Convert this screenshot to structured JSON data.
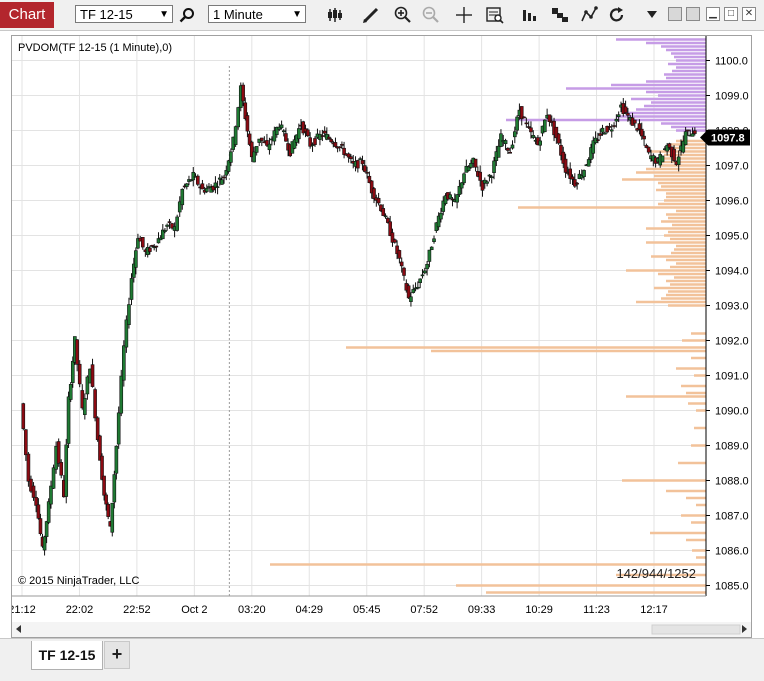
{
  "window": {
    "tab_label": "Chart",
    "instrument": "TF 12-15",
    "interval": "1 Minute"
  },
  "toolbar": {
    "icons": [
      "search-icon",
      "bar-type-icon",
      "draw-pencil-icon",
      "zoom-in-icon",
      "zoom-out-icon",
      "crosshair-icon",
      "data-box-icon",
      "indicators-icon",
      "strategies-icon",
      "drawing-tools-icon",
      "reload-icon",
      "dropdown-icon"
    ]
  },
  "chart": {
    "indicator_label": "PVDOM(TF 12-15 (1 Minute),0)",
    "copyright": "© 2015 NinjaTrader, LLC",
    "dom_totals": "142/944/1252",
    "last_price": "1097.8",
    "colors": {
      "up_candle": "#1f7a33",
      "down_candle": "#8b0a12",
      "ask_volume": "#c69ce6",
      "bid_volume": "#f2c29a",
      "grid": "#e3e3e3",
      "price_marker": "#000000"
    }
  },
  "chart_data": {
    "type": "candlestick",
    "ylim": [
      1084.7,
      1100.7
    ],
    "y_ticks": [
      "1085.0",
      "1086.0",
      "1087.0",
      "1088.0",
      "1089.0",
      "1090.0",
      "1091.0",
      "1092.0",
      "1093.0",
      "1094.0",
      "1095.0",
      "1096.0",
      "1097.0",
      "1098.0",
      "1099.0",
      "1100.0"
    ],
    "x_ticks": [
      "21:12",
      "22:02",
      "22:52",
      "Oct 2",
      "03:20",
      "04:29",
      "05:45",
      "07:52",
      "09:33",
      "10:29",
      "11:23",
      "12:17"
    ],
    "session_break": "Oct 2",
    "price_path": [
      [
        0,
        1090.2
      ],
      [
        5,
        1088.0
      ],
      [
        10,
        1087.4
      ],
      [
        14,
        1086.0
      ],
      [
        18,
        1087.3
      ],
      [
        23,
        1089.0
      ],
      [
        28,
        1087.6
      ],
      [
        31,
        1090.3
      ],
      [
        35,
        1092.0
      ],
      [
        40,
        1090.0
      ],
      [
        45,
        1091.3
      ],
      [
        50,
        1089.2
      ],
      [
        54,
        1087.6
      ],
      [
        58,
        1086.6
      ],
      [
        62,
        1089.0
      ],
      [
        67,
        1091.8
      ],
      [
        72,
        1093.8
      ],
      [
        76,
        1095.0
      ],
      [
        81,
        1094.5
      ],
      [
        88,
        1094.8
      ],
      [
        95,
        1095.3
      ],
      [
        100,
        1095.2
      ],
      [
        105,
        1096.3
      ],
      [
        112,
        1096.7
      ],
      [
        118,
        1096.3
      ],
      [
        125,
        1096.4
      ],
      [
        132,
        1096.7
      ],
      [
        138,
        1097.7
      ],
      [
        143,
        1099.2
      ],
      [
        150,
        1097.2
      ],
      [
        155,
        1097.8
      ],
      [
        160,
        1097.5
      ],
      [
        168,
        1098.2
      ],
      [
        175,
        1097.4
      ],
      [
        182,
        1098.2
      ],
      [
        188,
        1097.6
      ],
      [
        196,
        1097.9
      ],
      [
        203,
        1097.7
      ],
      [
        210,
        1097.4
      ],
      [
        216,
        1097.0
      ],
      [
        222,
        1097.1
      ],
      [
        228,
        1096.3
      ],
      [
        234,
        1095.8
      ],
      [
        240,
        1095.1
      ],
      [
        246,
        1094.3
      ],
      [
        252,
        1093.2
      ],
      [
        258,
        1093.6
      ],
      [
        264,
        1094.2
      ],
      [
        270,
        1095.3
      ],
      [
        276,
        1096.2
      ],
      [
        282,
        1095.9
      ],
      [
        288,
        1096.8
      ],
      [
        294,
        1097.1
      ],
      [
        300,
        1096.4
      ],
      [
        306,
        1096.8
      ],
      [
        312,
        1097.8
      ],
      [
        318,
        1097.4
      ],
      [
        324,
        1098.6
      ],
      [
        330,
        1098.0
      ],
      [
        336,
        1097.6
      ],
      [
        342,
        1098.5
      ],
      [
        348,
        1097.8
      ],
      [
        354,
        1096.9
      ],
      [
        360,
        1096.5
      ],
      [
        366,
        1096.9
      ],
      [
        372,
        1097.6
      ],
      [
        378,
        1098.0
      ],
      [
        384,
        1098.1
      ],
      [
        390,
        1098.7
      ],
      [
        396,
        1098.3
      ],
      [
        402,
        1098.0
      ],
      [
        408,
        1097.3
      ],
      [
        414,
        1097.1
      ],
      [
        420,
        1097.6
      ],
      [
        426,
        1097.1
      ],
      [
        432,
        1097.9
      ],
      [
        438,
        1098.0
      ]
    ],
    "candles_per_step": 1,
    "volume_profile": {
      "tick": 0.1,
      "ask": [
        {
          "price": 1100.6,
          "volume": 90
        },
        {
          "price": 1100.5,
          "volume": 60
        },
        {
          "price": 1100.4,
          "volume": 45
        },
        {
          "price": 1100.3,
          "volume": 40
        },
        {
          "price": 1100.2,
          "volume": 35
        },
        {
          "price": 1100.1,
          "volume": 32
        },
        {
          "price": 1100.0,
          "volume": 30
        },
        {
          "price": 1099.9,
          "volume": 38
        },
        {
          "price": 1099.8,
          "volume": 30
        },
        {
          "price": 1099.7,
          "volume": 34
        },
        {
          "price": 1099.6,
          "volume": 42
        },
        {
          "price": 1099.5,
          "volume": 40
        },
        {
          "price": 1099.4,
          "volume": 60
        },
        {
          "price": 1099.3,
          "volume": 95
        },
        {
          "price": 1099.2,
          "volume": 140
        },
        {
          "price": 1099.1,
          "volume": 60
        },
        {
          "price": 1099.0,
          "volume": 48
        },
        {
          "price": 1098.9,
          "volume": 75
        },
        {
          "price": 1098.8,
          "volume": 55
        },
        {
          "price": 1098.7,
          "volume": 62
        },
        {
          "price": 1098.6,
          "volume": 70
        },
        {
          "price": 1098.5,
          "volume": 80
        },
        {
          "price": 1098.4,
          "volume": 90
        },
        {
          "price": 1098.3,
          "volume": 200
        },
        {
          "price": 1098.2,
          "volume": 45
        },
        {
          "price": 1098.1,
          "volume": 35
        },
        {
          "price": 1098.0,
          "volume": 30
        }
      ],
      "bid": [
        {
          "price": 1097.7,
          "volume": 30
        },
        {
          "price": 1097.6,
          "volume": 35
        },
        {
          "price": 1097.5,
          "volume": 40
        },
        {
          "price": 1097.4,
          "volume": 55
        },
        {
          "price": 1097.3,
          "volume": 42
        },
        {
          "price": 1097.2,
          "volume": 48
        },
        {
          "price": 1097.1,
          "volume": 50
        },
        {
          "price": 1097.0,
          "volume": 45
        },
        {
          "price": 1096.9,
          "volume": 60
        },
        {
          "price": 1096.8,
          "volume": 70
        },
        {
          "price": 1096.7,
          "volume": 52
        },
        {
          "price": 1096.6,
          "volume": 84
        },
        {
          "price": 1096.5,
          "volume": 48
        },
        {
          "price": 1096.4,
          "volume": 45
        },
        {
          "price": 1096.3,
          "volume": 50
        },
        {
          "price": 1096.2,
          "volume": 40
        },
        {
          "price": 1096.1,
          "volume": 40
        },
        {
          "price": 1096.0,
          "volume": 42
        },
        {
          "price": 1095.9,
          "volume": 48
        },
        {
          "price": 1095.8,
          "volume": 188
        },
        {
          "price": 1095.7,
          "volume": 30
        },
        {
          "price": 1095.6,
          "volume": 40
        },
        {
          "price": 1095.5,
          "volume": 38
        },
        {
          "price": 1095.4,
          "volume": 45
        },
        {
          "price": 1095.3,
          "volume": 34
        },
        {
          "price": 1095.2,
          "volume": 60
        },
        {
          "price": 1095.1,
          "volume": 38
        },
        {
          "price": 1095.0,
          "volume": 42
        },
        {
          "price": 1094.9,
          "volume": 36
        },
        {
          "price": 1094.8,
          "volume": 60
        },
        {
          "price": 1094.7,
          "volume": 30
        },
        {
          "price": 1094.6,
          "volume": 32
        },
        {
          "price": 1094.5,
          "volume": 35
        },
        {
          "price": 1094.4,
          "volume": 55
        },
        {
          "price": 1094.3,
          "volume": 40
        },
        {
          "price": 1094.2,
          "volume": 30
        },
        {
          "price": 1094.1,
          "volume": 36
        },
        {
          "price": 1094.0,
          "volume": 80
        },
        {
          "price": 1093.9,
          "volume": 48
        },
        {
          "price": 1093.8,
          "volume": 32
        },
        {
          "price": 1093.7,
          "volume": 40
        },
        {
          "price": 1093.6,
          "volume": 36
        },
        {
          "price": 1093.5,
          "volume": 52
        },
        {
          "price": 1093.4,
          "volume": 38
        },
        {
          "price": 1093.3,
          "volume": 40
        },
        {
          "price": 1093.2,
          "volume": 45
        },
        {
          "price": 1093.1,
          "volume": 70
        },
        {
          "price": 1093.0,
          "volume": 38
        },
        {
          "price": 1092.2,
          "volume": 15
        },
        {
          "price": 1092.0,
          "volume": 24
        },
        {
          "price": 1091.8,
          "volume": 360
        },
        {
          "price": 1091.7,
          "volume": 275
        },
        {
          "price": 1091.5,
          "volume": 15
        },
        {
          "price": 1091.2,
          "volume": 30
        },
        {
          "price": 1091.0,
          "volume": 12
        },
        {
          "price": 1090.7,
          "volume": 25
        },
        {
          "price": 1090.5,
          "volume": 20
        },
        {
          "price": 1090.4,
          "volume": 80
        },
        {
          "price": 1090.2,
          "volume": 18
        },
        {
          "price": 1090.0,
          "volume": 10
        },
        {
          "price": 1089.5,
          "volume": 12
        },
        {
          "price": 1089.0,
          "volume": 15
        },
        {
          "price": 1088.5,
          "volume": 28
        },
        {
          "price": 1088.0,
          "volume": 84
        },
        {
          "price": 1087.7,
          "volume": 40
        },
        {
          "price": 1087.5,
          "volume": 20
        },
        {
          "price": 1087.3,
          "volume": 10
        },
        {
          "price": 1087.0,
          "volume": 25
        },
        {
          "price": 1086.8,
          "volume": 15
        },
        {
          "price": 1086.5,
          "volume": 56
        },
        {
          "price": 1086.3,
          "volume": 20
        },
        {
          "price": 1086.0,
          "volume": 14
        },
        {
          "price": 1085.8,
          "volume": 10
        },
        {
          "price": 1085.6,
          "volume": 436
        },
        {
          "price": 1085.3,
          "volume": 90
        },
        {
          "price": 1085.0,
          "volume": 250
        },
        {
          "price": 1084.8,
          "volume": 220
        }
      ]
    }
  }
}
